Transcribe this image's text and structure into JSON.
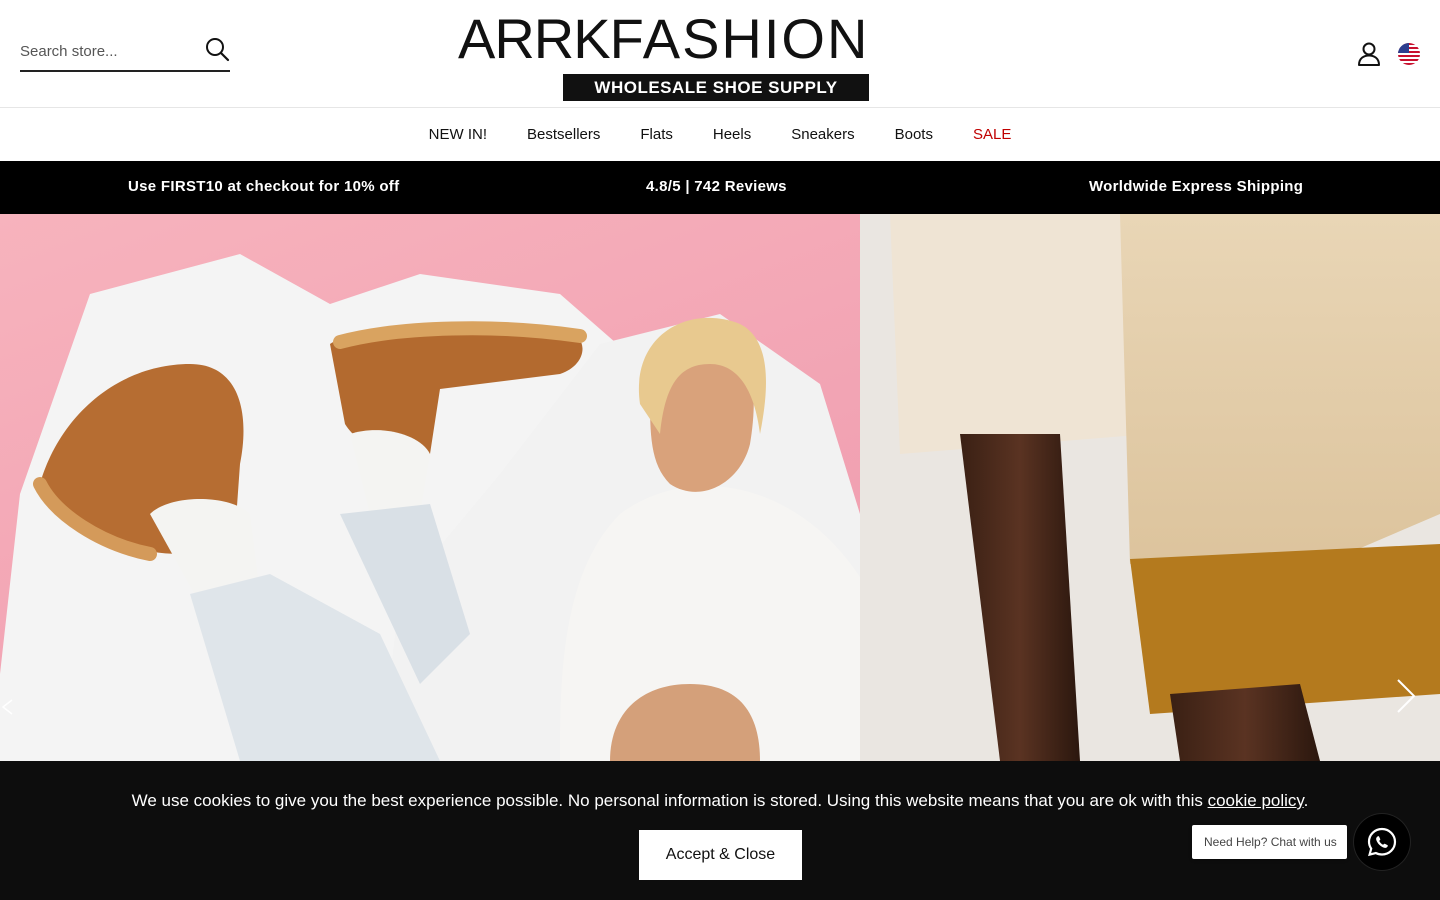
{
  "header": {
    "search_placeholder": "Search store...",
    "logo_part1": "ARRK",
    "logo_part2": "FASHION",
    "logo_tagline": "WHOLESALE SHOE SUPPLY",
    "account_icon": "user-icon",
    "region_icon": "us-flag-icon"
  },
  "nav": {
    "items": [
      "NEW IN!",
      "Bestsellers",
      "Flats",
      "Heels",
      "Sneakers",
      "Boots",
      "SALE"
    ],
    "sale_color": "#c00000"
  },
  "promo": {
    "discount": "Use FIRST10 at checkout for 10% off",
    "reviews": "4.8/5 | 742 Reviews",
    "shipping": "Worldwide Express Shipping"
  },
  "hero": {
    "next_icon": "chevron-right-icon"
  },
  "cookie": {
    "message": "We use cookies to give you the best experience possible. No personal information is stored. Using this website means that you are ok with this ",
    "link": "cookie policy",
    "suffix": ".",
    "accept_label": "Accept & Close"
  },
  "chat": {
    "bubble": "Need Help? Chat with us",
    "icon": "whatsapp-icon"
  },
  "colors": {
    "promo_bg": "#000000",
    "hero_pink": "#f4a9b3",
    "cookie_bg": "#0d0d0d"
  }
}
